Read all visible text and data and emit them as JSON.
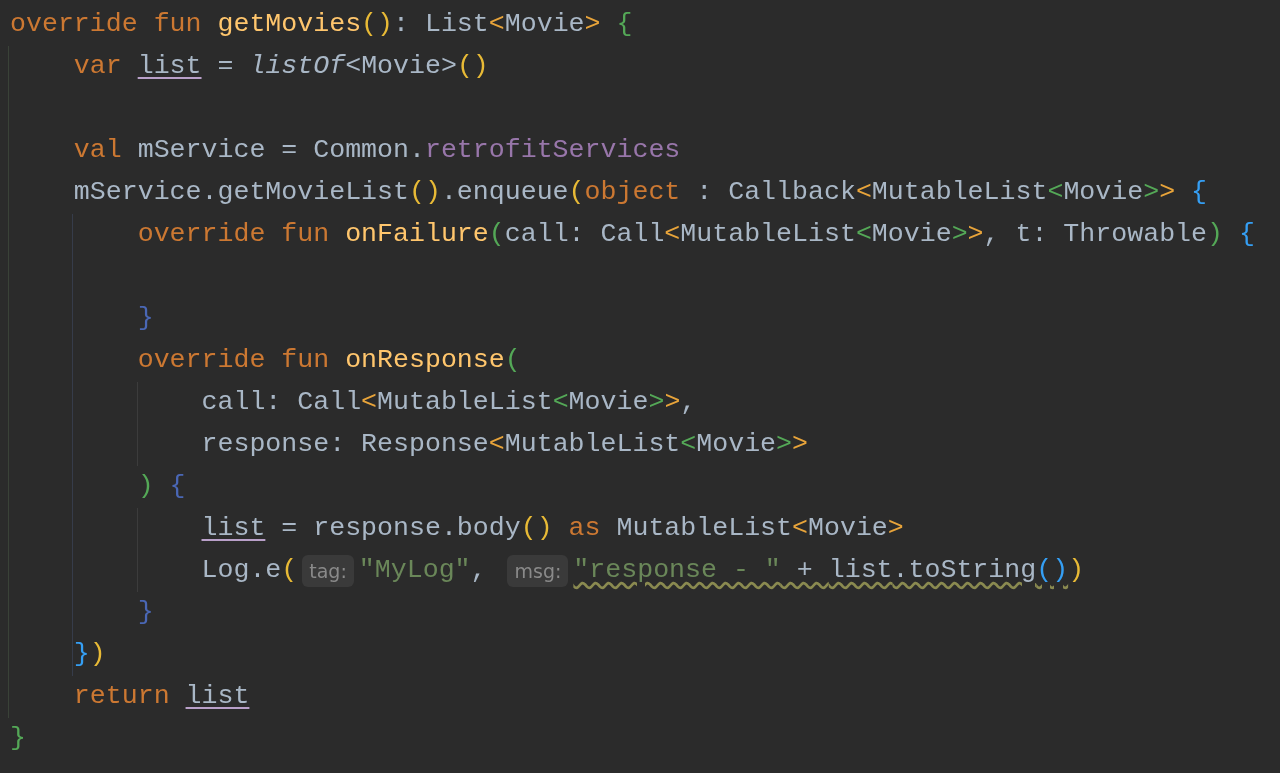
{
  "editor": {
    "lines": [
      {
        "kind": "code",
        "tokens": [
          {
            "text": "override fun ",
            "kind": "keyword"
          },
          {
            "text": "getMovies",
            "kind": "function"
          },
          {
            "text": "()",
            "kind": "paren_yellow"
          },
          {
            "text": ": List",
            "kind": "plain"
          },
          {
            "text": "<",
            "kind": "angle_orange"
          },
          {
            "text": "Movie",
            "kind": "plain"
          },
          {
            "text": ">",
            "kind": "angle_orange"
          },
          {
            "text": " {",
            "kind": "brace_green"
          }
        ]
      },
      {
        "kind": "code",
        "tokens": [
          {
            "text": "    var ",
            "kind": "keyword"
          },
          {
            "text": "list",
            "kind": "variable"
          },
          {
            "text": " = ",
            "kind": "plain"
          },
          {
            "text": "listOf",
            "kind": "italic"
          },
          {
            "text": "<Movie>",
            "kind": "plain"
          },
          {
            "text": "()",
            "kind": "paren_yellow"
          }
        ]
      },
      {
        "kind": "blank"
      },
      {
        "kind": "code",
        "tokens": [
          {
            "text": "    val",
            "kind": "keyword"
          },
          {
            "text": " mService = Common.",
            "kind": "plain"
          },
          {
            "text": "retrofitServices",
            "kind": "property"
          }
        ]
      },
      {
        "kind": "code",
        "tokens": [
          {
            "text": "    mService.getMovieList",
            "kind": "plain"
          },
          {
            "text": "()",
            "kind": "paren_yellow"
          },
          {
            "text": ".enqueue",
            "kind": "plain"
          },
          {
            "text": "(",
            "kind": "paren_yellow"
          },
          {
            "text": "object",
            "kind": "keyword"
          },
          {
            "text": " : Callback",
            "kind": "plain"
          },
          {
            "text": "<",
            "kind": "angle_orange"
          },
          {
            "text": "MutableList",
            "kind": "plain"
          },
          {
            "text": "<",
            "kind": "angle_green"
          },
          {
            "text": "Movie",
            "kind": "plain"
          },
          {
            "text": ">",
            "kind": "angle_green"
          },
          {
            "text": ">",
            "kind": "angle_orange"
          },
          {
            "text": " {",
            "kind": "brace_blue"
          }
        ]
      },
      {
        "kind": "code",
        "tokens": [
          {
            "text": "        override fun ",
            "kind": "keyword"
          },
          {
            "text": "onFailure",
            "kind": "function"
          },
          {
            "text": "(",
            "kind": "brace_green"
          },
          {
            "text": "call: Call",
            "kind": "plain"
          },
          {
            "text": "<",
            "kind": "angle_orange"
          },
          {
            "text": "MutableList",
            "kind": "plain"
          },
          {
            "text": "<",
            "kind": "angle_green"
          },
          {
            "text": "Movie",
            "kind": "plain"
          },
          {
            "text": ">",
            "kind": "angle_green"
          },
          {
            "text": ">",
            "kind": "angle_orange"
          },
          {
            "text": ", t: Throwable",
            "kind": "plain"
          },
          {
            "text": ")",
            "kind": "brace_green"
          },
          {
            "text": " {",
            "kind": "brace_blue"
          }
        ]
      },
      {
        "kind": "blank"
      },
      {
        "kind": "code",
        "tokens": [
          {
            "text": "        }",
            "kind": "brace_dark_blue"
          }
        ]
      },
      {
        "kind": "code",
        "tokens": [
          {
            "text": "        override fun ",
            "kind": "keyword"
          },
          {
            "text": "onResponse",
            "kind": "function"
          },
          {
            "text": "(",
            "kind": "brace_green"
          }
        ]
      },
      {
        "kind": "code",
        "tokens": [
          {
            "text": "            call: Call",
            "kind": "plain"
          },
          {
            "text": "<",
            "kind": "angle_orange"
          },
          {
            "text": "MutableList",
            "kind": "plain"
          },
          {
            "text": "<",
            "kind": "angle_green"
          },
          {
            "text": "Movie",
            "kind": "plain"
          },
          {
            "text": ">",
            "kind": "angle_green"
          },
          {
            "text": ">",
            "kind": "angle_orange"
          },
          {
            "text": ",",
            "kind": "plain"
          }
        ]
      },
      {
        "kind": "code",
        "tokens": [
          {
            "text": "            response: Response",
            "kind": "plain"
          },
          {
            "text": "<",
            "kind": "angle_orange"
          },
          {
            "text": "MutableList",
            "kind": "plain"
          },
          {
            "text": "<",
            "kind": "angle_green"
          },
          {
            "text": "Movie",
            "kind": "plain"
          },
          {
            "text": ">",
            "kind": "angle_green"
          },
          {
            "text": ">",
            "kind": "angle_orange"
          }
        ]
      },
      {
        "kind": "code",
        "tokens": [
          {
            "text": "        )",
            "kind": "brace_green"
          },
          {
            "text": " {",
            "kind": "brace_dark_blue"
          }
        ]
      },
      {
        "kind": "code",
        "tokens": [
          {
            "text": "            list",
            "kind": "variable"
          },
          {
            "text": " = response.body",
            "kind": "plain"
          },
          {
            "text": "()",
            "kind": "paren_yellow"
          },
          {
            "text": " as",
            "kind": "keyword"
          },
          {
            "text": " MutableList",
            "kind": "plain"
          },
          {
            "text": "<",
            "kind": "angle_orange"
          },
          {
            "text": "Movie",
            "kind": "plain"
          },
          {
            "text": ">",
            "kind": "angle_orange"
          }
        ]
      },
      {
        "kind": "code",
        "tokens": [
          {
            "text": "            Log.e",
            "kind": "plain"
          },
          {
            "text": "(",
            "kind": "paren_yellow"
          },
          {
            "text": "tag:",
            "kind": "hint"
          },
          {
            "text": "\"MyLog\"",
            "kind": "string"
          },
          {
            "text": ", ",
            "kind": "plain"
          },
          {
            "text": "msg:",
            "kind": "hint"
          },
          {
            "text": "\"response - \"",
            "kind": "string_warning"
          },
          {
            "text": " + ",
            "kind": "plain_warning"
          },
          {
            "text": "list",
            "kind": "variable_warning"
          },
          {
            "text": ".toString",
            "kind": "plain_warning"
          },
          {
            "text": "()",
            "kind": "brace_blue_warning"
          },
          {
            "text": ")",
            "kind": "paren_yellow"
          }
        ]
      },
      {
        "kind": "code",
        "tokens": [
          {
            "text": "        }",
            "kind": "brace_dark_blue"
          }
        ]
      },
      {
        "kind": "code",
        "tokens": [
          {
            "text": "    }",
            "kind": "brace_blue"
          },
          {
            "text": ")",
            "kind": "paren_yellow"
          }
        ]
      },
      {
        "kind": "code",
        "tokens": [
          {
            "text": "    return ",
            "kind": "keyword"
          },
          {
            "text": "list",
            "kind": "variable"
          }
        ]
      },
      {
        "kind": "code",
        "tokens": [
          {
            "text": "}",
            "kind": "brace_green"
          }
        ]
      }
    ]
  }
}
